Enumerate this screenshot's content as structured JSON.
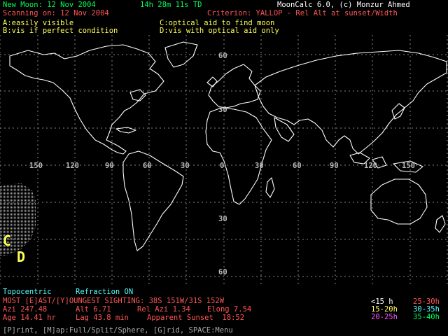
{
  "header": {
    "new_moon": "New Moon: 12 Nov 2004",
    "time": "14h 28m 11s TD",
    "app": "MoonCalc 6.0, (c) Monzur Ahmed",
    "scanning": "Scanning on: 12 Nov 2004",
    "criterion": "Criterion: YALLOP - Rel Alt at sunset/Width"
  },
  "legend": {
    "a": "A:easily visible",
    "b": "B:vis if perfect condition",
    "c": "C:optical aid to find moon",
    "d": "D:vis with optical aid only"
  },
  "map": {
    "lat_labels": [
      "60",
      "30",
      "0",
      "30",
      "60"
    ],
    "lon_labels": [
      "150",
      "120",
      "90",
      "60",
      "30",
      "0",
      "30",
      "60",
      "90",
      "120",
      "150"
    ],
    "zone_c": "C",
    "zone_d": "D"
  },
  "status": {
    "mode": "Topocentric",
    "refraction": "Refraction ON",
    "sighting": "MOST [E]AST/[Y]OUNGEST SIGHTING: 38S 151W/31S 152W",
    "azi": "Azi 247.48",
    "alt": "Alt 6.71",
    "rel_azi": "Rel Azi 1.34",
    "elong": "Elong 7.54",
    "age": "Age 14.41 hr",
    "lag": "Lag 43.8 min",
    "sunset": "Apparent Sunset  18:52"
  },
  "age_legend": {
    "l1": "<15 h",
    "l2": "25-30h",
    "l3": "15-20h",
    "l4": "30-35h",
    "l5": "20-25h",
    "l6": "35-40h"
  },
  "menu": "[P]rint, [M]ap:Full/Split/Sphere, [G]rid, SPACE:Menu"
}
